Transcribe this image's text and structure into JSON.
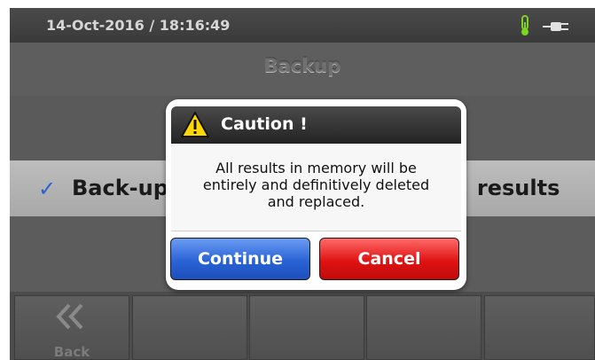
{
  "status_bar": {
    "datetime": "14-Oct-2016 / 18:16:49",
    "icons": [
      "thermometer-icon",
      "power-plug-icon"
    ]
  },
  "page": {
    "title": "Backup"
  },
  "option": {
    "checked": true,
    "label": "Back-up results",
    "label_visible_left": "Back-up",
    "label_visible_right": "results"
  },
  "bottom_bar": {
    "back_label": "Back",
    "back_icon": "double-chevron-left-icon"
  },
  "dialog": {
    "title": "Caution !",
    "icon": "warning-icon",
    "message_lines": [
      "All results in memory will be",
      "entirely and definitively deleted",
      "and replaced."
    ],
    "continue_label": "Continue",
    "cancel_label": "Cancel"
  },
  "colors": {
    "continue_button": "#2a63d6",
    "cancel_button": "#e01313",
    "check": "#2a5fd0",
    "warning_yellow": "#ffd800"
  }
}
